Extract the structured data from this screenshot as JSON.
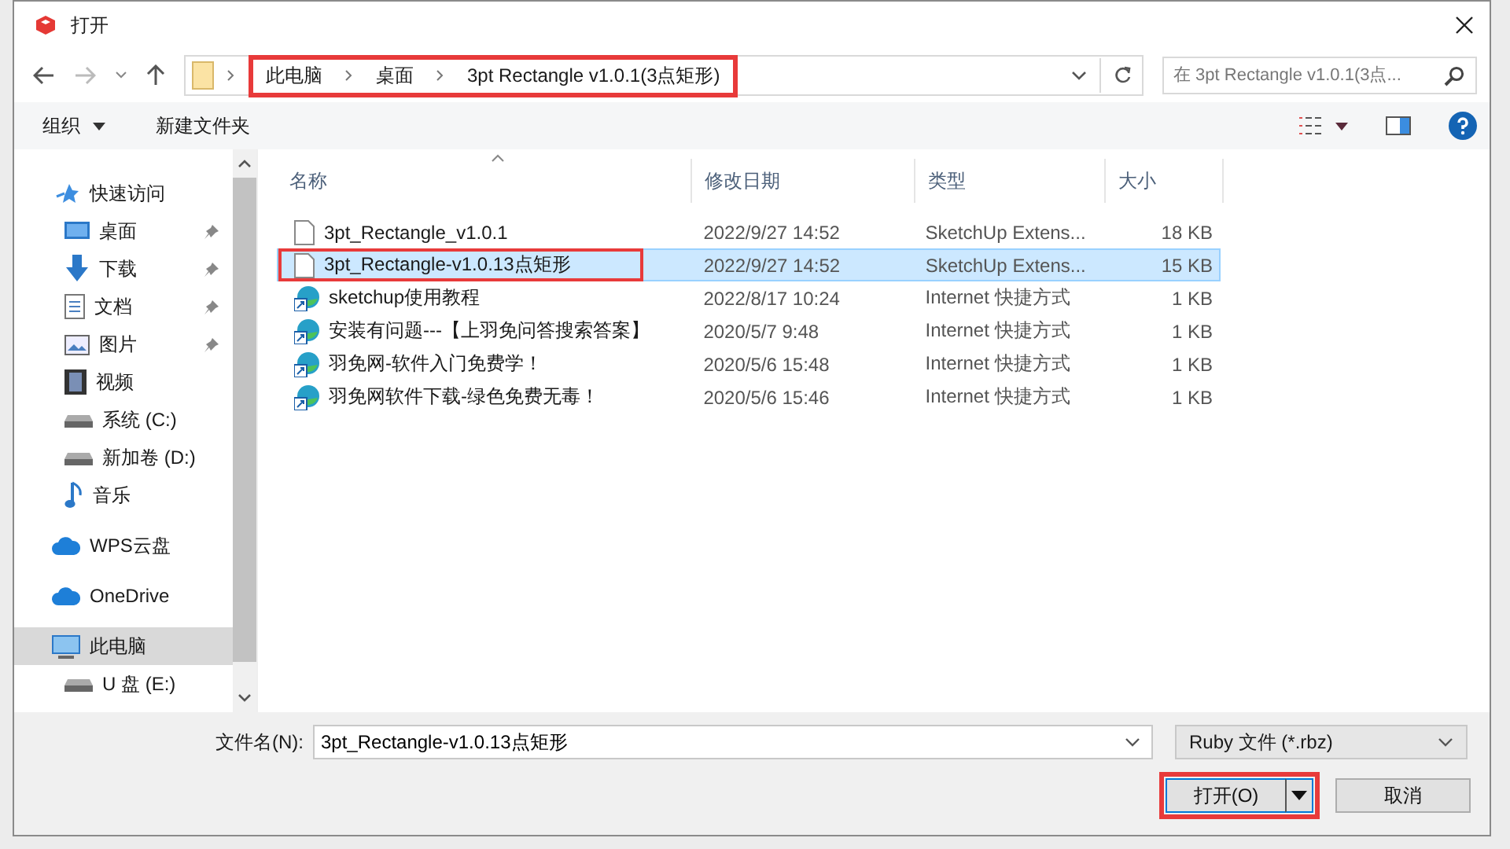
{
  "window": {
    "title": "打开"
  },
  "address": {
    "highlighted": true,
    "path": [
      {
        "label": "此电脑"
      },
      {
        "label": "桌面"
      },
      {
        "label": "3pt Rectangle v1.0.1(3点矩形)"
      }
    ]
  },
  "search": {
    "placeholder": "在 3pt Rectangle v1.0.1(3点..."
  },
  "toolbar": {
    "organize": "组织",
    "new_folder": "新建文件夹"
  },
  "sidebar": {
    "items": [
      {
        "label": "快速访问",
        "kind": "star",
        "pinned": false,
        "selected": false
      },
      {
        "label": "桌面",
        "kind": "desktop",
        "pinned": true,
        "selected": false
      },
      {
        "label": "下载",
        "kind": "download",
        "pinned": true,
        "selected": false
      },
      {
        "label": "文档",
        "kind": "document",
        "pinned": true,
        "selected": false
      },
      {
        "label": "图片",
        "kind": "image",
        "pinned": true,
        "selected": false
      },
      {
        "label": "视频",
        "kind": "video",
        "pinned": false,
        "selected": false
      },
      {
        "label": "系统 (C:)",
        "kind": "drive",
        "pinned": false,
        "selected": false
      },
      {
        "label": "新加卷 (D:)",
        "kind": "drive",
        "pinned": false,
        "selected": false
      },
      {
        "label": "音乐",
        "kind": "music",
        "pinned": false,
        "selected": false
      },
      {
        "label": "WPS云盘",
        "kind": "cloud",
        "pinned": false,
        "selected": false
      },
      {
        "label": "OneDrive",
        "kind": "cloud",
        "pinned": false,
        "selected": false
      },
      {
        "label": "此电脑",
        "kind": "computer",
        "pinned": false,
        "selected": true
      },
      {
        "label": "U 盘 (E:)",
        "kind": "drive",
        "pinned": false,
        "selected": false
      }
    ]
  },
  "table": {
    "columns": [
      {
        "label": "名称",
        "sorted": true
      },
      {
        "label": "修改日期",
        "sorted": false
      },
      {
        "label": "类型",
        "sorted": false
      },
      {
        "label": "大小",
        "sorted": false
      }
    ],
    "rows": [
      {
        "name": "3pt_Rectangle_v1.0.1",
        "date": "2022/9/27 14:52",
        "type": "SketchUp Extens...",
        "size": "18 KB",
        "kind": "file",
        "selected": false,
        "highlighted": false
      },
      {
        "name": "3pt_Rectangle-v1.0.13点矩形",
        "date": "2022/9/27 14:52",
        "type": "SketchUp Extens...",
        "size": "15 KB",
        "kind": "file",
        "selected": true,
        "highlighted": true
      },
      {
        "name": "sketchup使用教程",
        "date": "2022/8/17 10:24",
        "type": "Internet 快捷方式",
        "size": "1 KB",
        "kind": "shortcut",
        "selected": false,
        "highlighted": false
      },
      {
        "name": "安装有问题---【上羽免问答搜索答案】",
        "date": "2020/5/7 9:48",
        "type": "Internet 快捷方式",
        "size": "1 KB",
        "kind": "shortcut",
        "selected": false,
        "highlighted": false
      },
      {
        "name": "羽免网-软件入门免费学！",
        "date": "2020/5/6 15:48",
        "type": "Internet 快捷方式",
        "size": "1 KB",
        "kind": "shortcut",
        "selected": false,
        "highlighted": false
      },
      {
        "name": "羽免网软件下载-绿色免费无毒！",
        "date": "2020/5/6 15:46",
        "type": "Internet 快捷方式",
        "size": "1 KB",
        "kind": "shortcut",
        "selected": false,
        "highlighted": false
      }
    ]
  },
  "filename": {
    "label": "文件名(N):",
    "value": "3pt_Rectangle-v1.0.13点矩形"
  },
  "filter": {
    "value": "Ruby 文件 (*.rbz)"
  },
  "buttons": {
    "open": {
      "label": "打开(O)",
      "highlighted": true
    },
    "cancel": {
      "label": "取消"
    }
  }
}
